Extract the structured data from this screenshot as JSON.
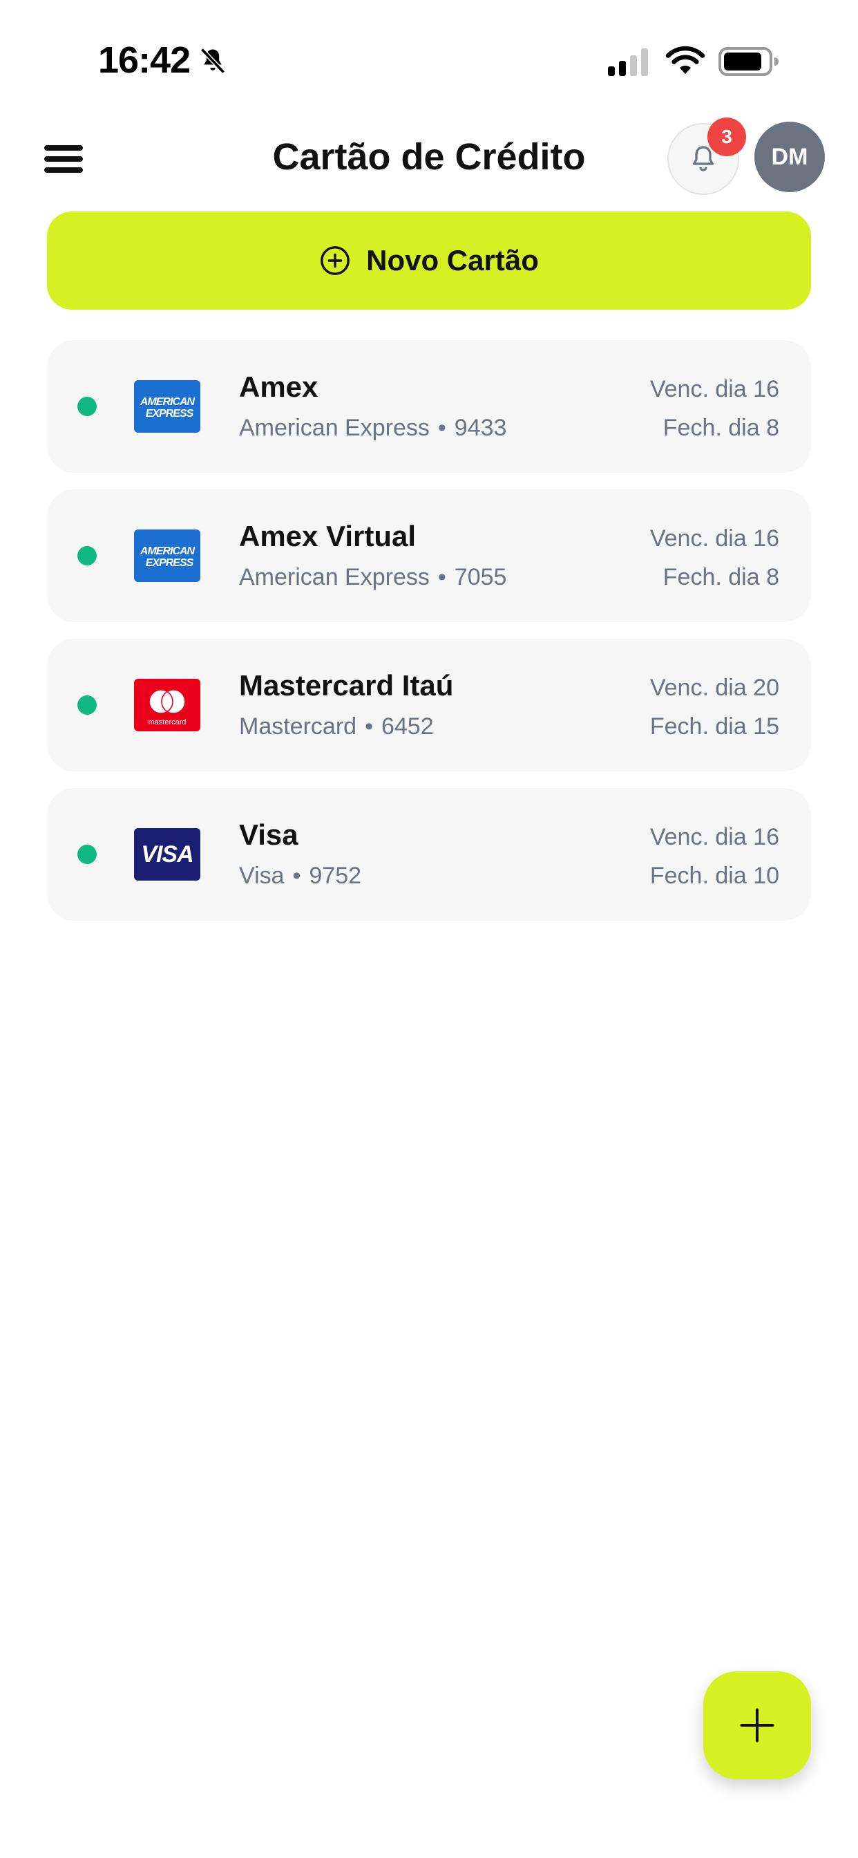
{
  "status_bar": {
    "time": "16:42",
    "icons": [
      "bell-slash-icon",
      "cellular-signal-icon",
      "wifi-icon",
      "battery-icon"
    ]
  },
  "header": {
    "title": "Cartão de Crédito",
    "notification_count": "3",
    "avatar_initials": "DM"
  },
  "new_card_button": {
    "label": "Novo Cartão",
    "icon": "plus-circle-icon"
  },
  "cards": [
    {
      "name": "Amex",
      "brand": "American Express",
      "last4": "9433",
      "due": "Venc. dia 16",
      "closing": "Fech. dia 8",
      "logo": "amex-logo",
      "status_color": "#10b981"
    },
    {
      "name": "Amex Virtual",
      "brand": "American Express",
      "last4": "7055",
      "due": "Venc. dia 16",
      "closing": "Fech. dia 8",
      "logo": "amex-logo",
      "status_color": "#10b981"
    },
    {
      "name": "Mastercard Itaú",
      "brand": "Mastercard",
      "last4": "6452",
      "due": "Venc. dia 20",
      "closing": "Fech. dia 15",
      "logo": "mastercard-logo",
      "status_color": "#10b981"
    },
    {
      "name": "Visa",
      "brand": "Visa",
      "last4": "9752",
      "due": "Venc. dia 16",
      "closing": "Fech. dia 10",
      "logo": "visa-logo",
      "status_color": "#10b981"
    }
  ],
  "separator": "•",
  "logo_text": {
    "amex_line1": "AMERICAN",
    "amex_line2": "EXPRESS",
    "mastercard": "mastercard",
    "visa": "VISA"
  },
  "colors": {
    "accent": "#d6f123",
    "card_bg": "#f6f6f6",
    "active_status": "#10b981",
    "badge": "#ef4444",
    "avatar_bg": "#6b7280",
    "secondary_text": "#6b7280",
    "amex_blue": "#1a6fd0",
    "mastercard_red": "#eb001b",
    "visa_navy": "#1a1f71"
  },
  "fab": {
    "icon": "plus-icon"
  }
}
